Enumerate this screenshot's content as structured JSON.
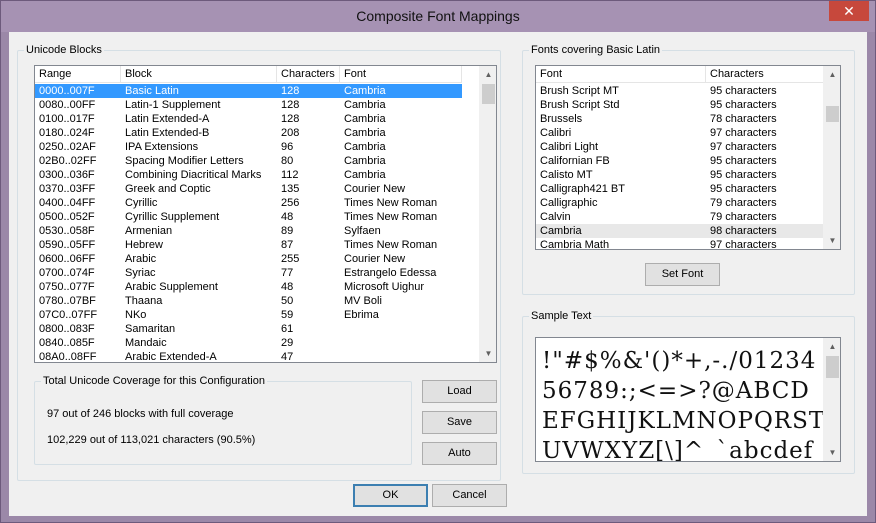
{
  "window": {
    "title": "Composite Font Mappings",
    "close_glyph": "✕"
  },
  "unicode_blocks": {
    "group_label": "Unicode Blocks",
    "columns": [
      "Range",
      "Block",
      "Characters",
      "Font"
    ],
    "rows": [
      [
        "0000..007F",
        "Basic Latin",
        "128",
        "Cambria"
      ],
      [
        "0080..00FF",
        "Latin-1 Supplement",
        "128",
        "Cambria"
      ],
      [
        "0100..017F",
        "Latin Extended-A",
        "128",
        "Cambria"
      ],
      [
        "0180..024F",
        "Latin Extended-B",
        "208",
        "Cambria"
      ],
      [
        "0250..02AF",
        "IPA Extensions",
        "96",
        "Cambria"
      ],
      [
        "02B0..02FF",
        "Spacing Modifier Letters",
        "80",
        "Cambria"
      ],
      [
        "0300..036F",
        "Combining Diacritical Marks",
        "112",
        "Cambria"
      ],
      [
        "0370..03FF",
        "Greek and Coptic",
        "135",
        "Courier New"
      ],
      [
        "0400..04FF",
        "Cyrillic",
        "256",
        "Times New Roman"
      ],
      [
        "0500..052F",
        "Cyrillic Supplement",
        "48",
        "Times New Roman"
      ],
      [
        "0530..058F",
        "Armenian",
        "89",
        "Sylfaen"
      ],
      [
        "0590..05FF",
        "Hebrew",
        "87",
        "Times New Roman"
      ],
      [
        "0600..06FF",
        "Arabic",
        "255",
        "Courier New"
      ],
      [
        "0700..074F",
        "Syriac",
        "77",
        "Estrangelo Edessa"
      ],
      [
        "0750..077F",
        "Arabic Supplement",
        "48",
        "Microsoft Uighur"
      ],
      [
        "0780..07BF",
        "Thaana",
        "50",
        "MV Boli"
      ],
      [
        "07C0..07FF",
        "NKo",
        "59",
        "Ebrima"
      ],
      [
        "0800..083F",
        "Samaritan",
        "61",
        ""
      ],
      [
        "0840..085F",
        "Mandaic",
        "29",
        ""
      ],
      [
        "08A0..08FF",
        "Arabic Extended-A",
        "47",
        ""
      ]
    ]
  },
  "coverage": {
    "group_label": "Total Unicode Coverage for this Configuration",
    "blocks_line": "97 out of 246 blocks with full coverage",
    "chars_line": "102,229 out of 113,021 characters (90.5%)"
  },
  "side_buttons": {
    "load": "Load",
    "save": "Save",
    "auto": "Auto"
  },
  "fonts_covering": {
    "group_label": "Fonts covering Basic Latin",
    "columns": [
      "Font",
      "Characters"
    ],
    "rows": [
      [
        "Brush Script MT",
        "95 characters"
      ],
      [
        "Brush Script Std",
        "95 characters"
      ],
      [
        "Brussels",
        "78 characters"
      ],
      [
        "Calibri",
        "97 characters"
      ],
      [
        "Calibri Light",
        "97 characters"
      ],
      [
        "Californian FB",
        "95 characters"
      ],
      [
        "Calisto MT",
        "95 characters"
      ],
      [
        "Calligraph421 BT",
        "95 characters"
      ],
      [
        "Calligraphic",
        "79 characters"
      ],
      [
        "Calvin",
        "79 characters"
      ],
      [
        "Cambria",
        "98 characters"
      ],
      [
        "Cambria Math",
        "97 characters"
      ]
    ],
    "set_font_button": "Set Font"
  },
  "sample": {
    "group_label": "Sample Text",
    "text": "!\"#$%&'()*+,-./0123456789:;<=>?@ABCDEFGHIJKLMNOPQRSTUVWXYZ[\\]^_`abcdef"
  },
  "dialog_buttons": {
    "ok": "OK",
    "cancel": "Cancel"
  },
  "icons": {
    "scroll_up": "▲",
    "scroll_down": "▼"
  }
}
